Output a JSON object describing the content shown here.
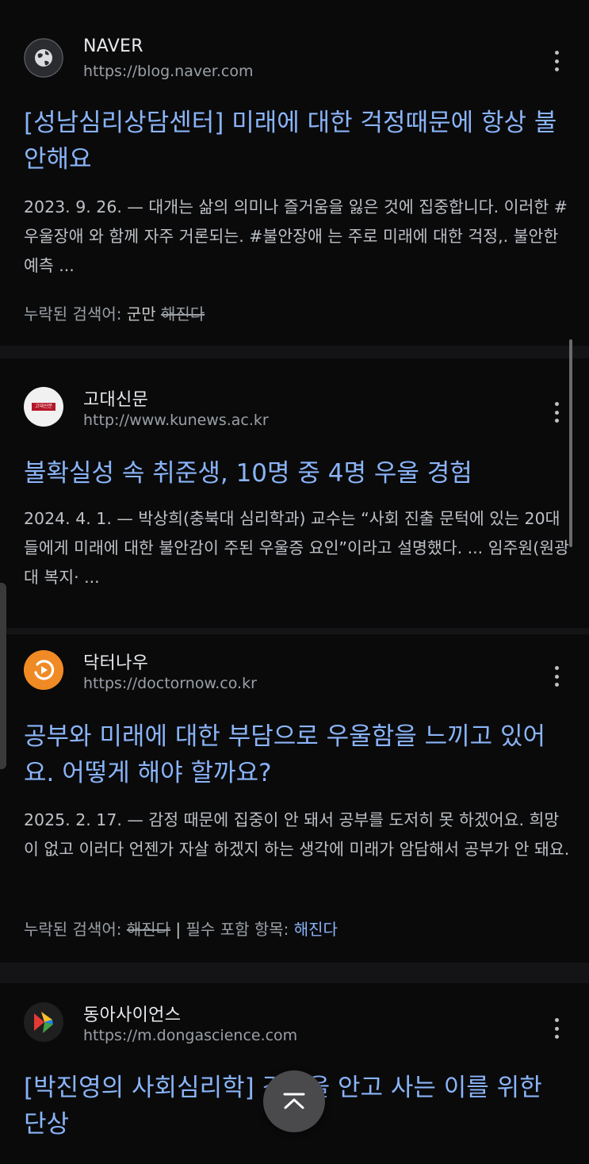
{
  "results": [
    {
      "site_name": "NAVER",
      "url": "https://blog.naver.com",
      "title": "[성남심리상담센터] 미래에 대한 걱정때문에 항상 불안해요",
      "snippet": "2023. 9. 26. — 대개는 삶의 의미나 즐거움을 잃은 것에 집중합니다. 이러한 #우울장애 와 함께 자주 거론되는. #불안장애 는 주로 미래에 대한 걱정,. 불안한 예측 ...",
      "missing_label": "누락된 검색어:",
      "missing_terms": [
        "군만",
        "해진다"
      ]
    },
    {
      "site_name": "고대신문",
      "url": "http://www.kunews.ac.kr",
      "favicon_text": "고대신문",
      "title": "불확실성 속 취준생, 10명 중 4명 우울 경험",
      "snippet": "2024. 4. 1. — 박상희(충북대 심리학과) 교수는 “사회 진출 문턱에 있는 20대들에게 미래에 대한 불안감이 주된 우울증 요인”이라고 설명했다. ... 임주원(원광대 복지· ..."
    },
    {
      "site_name": "닥터나우",
      "url": "https://doctornow.co.kr",
      "title": "공부와 미래에 대한 부담으로 우울함을 느끼고 있어요. 어떻게 해야 할까요?",
      "snippet": "2025. 2. 17. — 감정 때문에 집중이 안 돼서 공부를 도저히 못 하겠어요. 희망이 없고 이러다 언젠가 자살 하겠지 하는 생각에 미래가 암담해서 공부가 안 돼요.",
      "missing_label": "누락된 검색어:",
      "missing_term": "해진다",
      "required_label": "필수 포함 항목:",
      "required_term": "해진다"
    },
    {
      "site_name": "동아사이언스",
      "url": "https://m.dongascience.com",
      "title": "[박진영의 사회심리학] 걱정을 안고 사는 이를 위한 단상"
    }
  ],
  "icons": {
    "globe": "globe-icon",
    "more": "more-vert-icon",
    "scroll_top": "chevron-up-icon"
  },
  "colors": {
    "link": "#8ab4f8",
    "background": "#0a0a0b",
    "doctornow": "#f08a24"
  }
}
